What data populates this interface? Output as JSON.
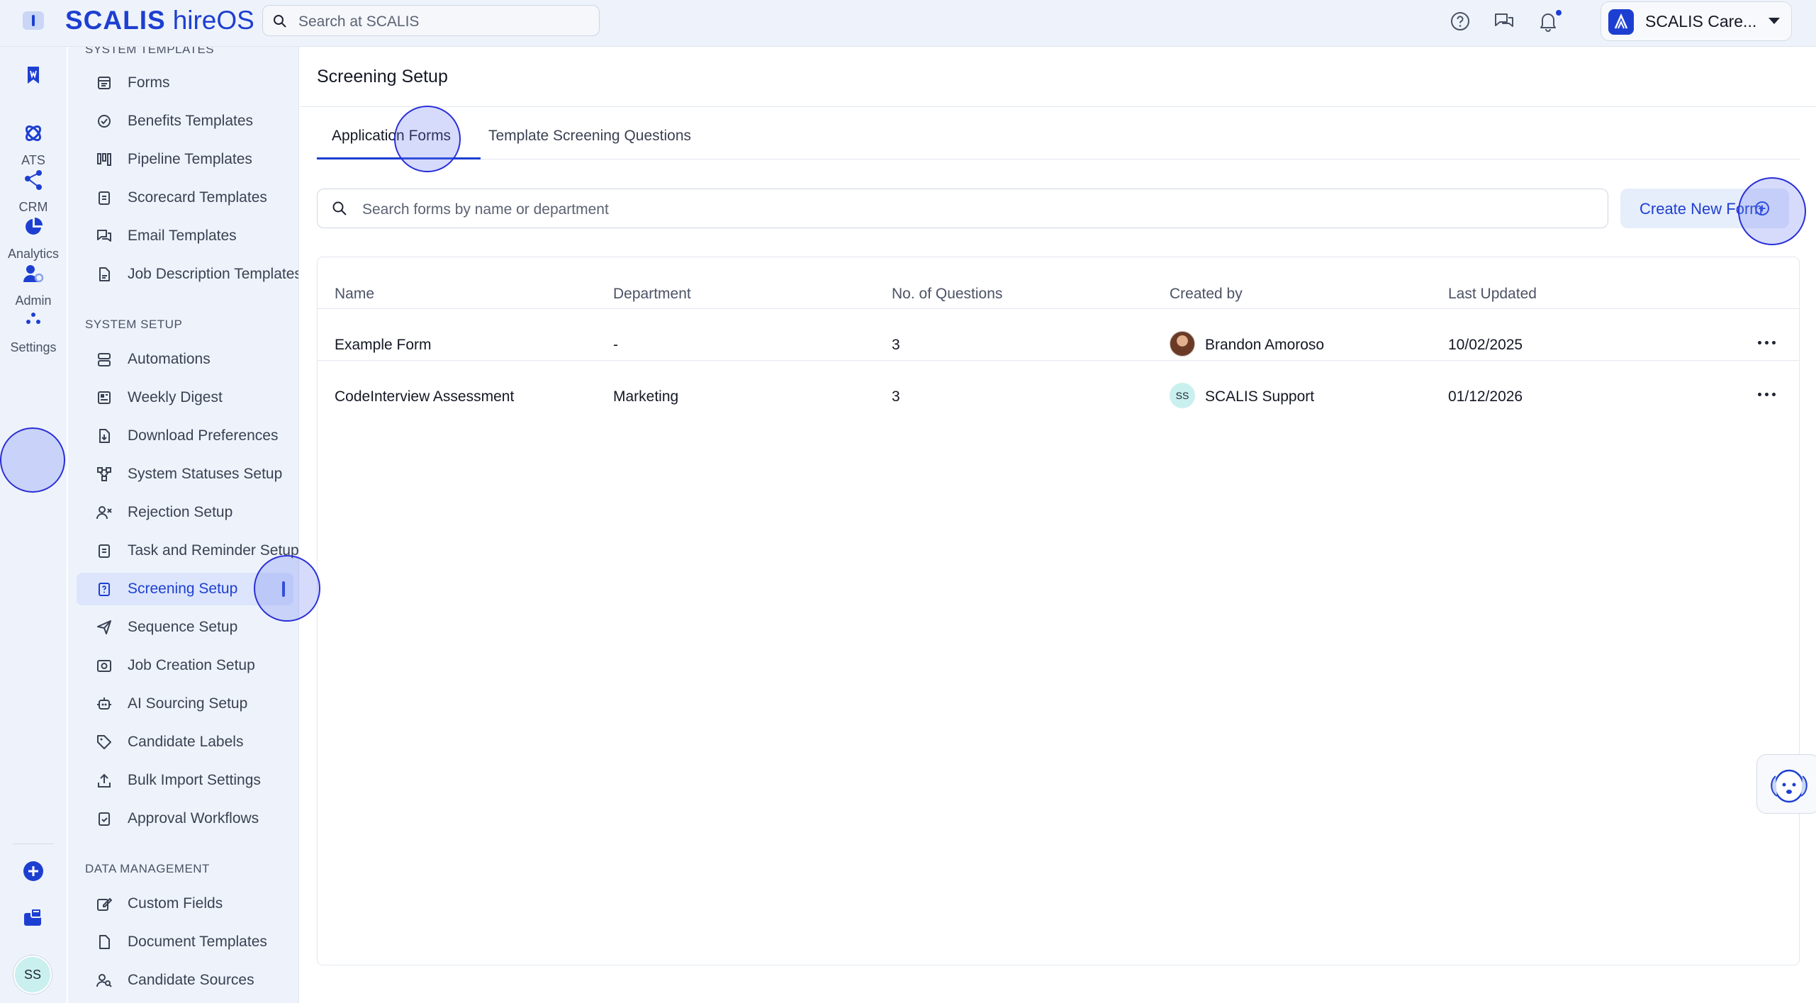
{
  "app": {
    "logo_main": "SCALIS",
    "logo_sub": "hireOS",
    "search_placeholder": "Search at SCALIS",
    "company_name": "SCALIS Care..."
  },
  "rail": {
    "items": [
      {
        "icon": "bookmark-icon",
        "label": ""
      },
      {
        "icon": "ats-icon",
        "label": "ATS"
      },
      {
        "icon": "crm-icon",
        "label": "CRM"
      },
      {
        "icon": "analytics-icon",
        "label": "Analytics"
      },
      {
        "icon": "admin-icon",
        "label": "Admin"
      },
      {
        "icon": "settings-icon",
        "label": "Settings"
      }
    ],
    "user_initials": "SS"
  },
  "sidebar": {
    "section_templates": "SYSTEM TEMPLATES",
    "section_setup": "SYSTEM SETUP",
    "section_data": "DATA MANAGEMENT",
    "templates": [
      {
        "label": "Forms",
        "icon": "form-icon"
      },
      {
        "label": "Benefits Templates",
        "icon": "badge-check-icon"
      },
      {
        "label": "Pipeline Templates",
        "icon": "pipeline-icon"
      },
      {
        "label": "Scorecard Templates",
        "icon": "clipboard-icon"
      },
      {
        "label": "Email Templates",
        "icon": "chat-icon"
      },
      {
        "label": "Job Description Templates",
        "icon": "document-icon"
      }
    ],
    "setup": [
      {
        "label": "Automations",
        "icon": "automation-icon"
      },
      {
        "label": "Weekly Digest",
        "icon": "newspaper-icon"
      },
      {
        "label": "Download Preferences",
        "icon": "download-file-icon"
      },
      {
        "label": "System Statuses Setup",
        "icon": "flow-icon"
      },
      {
        "label": "Rejection Setup",
        "icon": "user-x-icon"
      },
      {
        "label": "Task and Reminder Setup",
        "icon": "clipboard-list-icon"
      },
      {
        "label": "Screening Setup",
        "icon": "clipboard-question-icon"
      },
      {
        "label": "Sequence Setup",
        "icon": "send-icon"
      },
      {
        "label": "Job Creation Setup",
        "icon": "camera-box-icon"
      },
      {
        "label": "AI Sourcing Setup",
        "icon": "robot-icon"
      },
      {
        "label": "Candidate Labels",
        "icon": "tag-icon"
      },
      {
        "label": "Bulk Import Settings",
        "icon": "upload-icon"
      },
      {
        "label": "Approval Workflows",
        "icon": "clipboard-check-icon"
      }
    ],
    "data": [
      {
        "label": "Custom Fields",
        "icon": "edit-box-icon"
      },
      {
        "label": "Document Templates",
        "icon": "file-icon"
      },
      {
        "label": "Candidate Sources",
        "icon": "user-search-icon"
      }
    ]
  },
  "main": {
    "title": "Screening Setup",
    "tabs": [
      "Application Forms",
      "Template Screening Questions"
    ],
    "active_tab": "Application Forms",
    "search_placeholder": "Search forms by name or department",
    "create_button": "Create New Form",
    "columns": [
      "Name",
      "Department",
      "No. of Questions",
      "Created by",
      "Last Updated"
    ],
    "rows": [
      {
        "name": "Example Form",
        "department": "-",
        "questions": "3",
        "created_by": "Brandon Amoroso",
        "creator_avatar": "photo",
        "last_updated": "10/02/2025"
      },
      {
        "name": "CodeInterview Assessment",
        "department": "Marketing",
        "questions": "3",
        "created_by": "SCALIS Support",
        "creator_avatar": "SS",
        "last_updated": "01/12/2026"
      }
    ]
  },
  "colors": {
    "brand": "#1d3fd1",
    "chrome_bg": "#eef3fb",
    "active_bg": "#dce5fb",
    "highlight": "#2a2fd6"
  }
}
